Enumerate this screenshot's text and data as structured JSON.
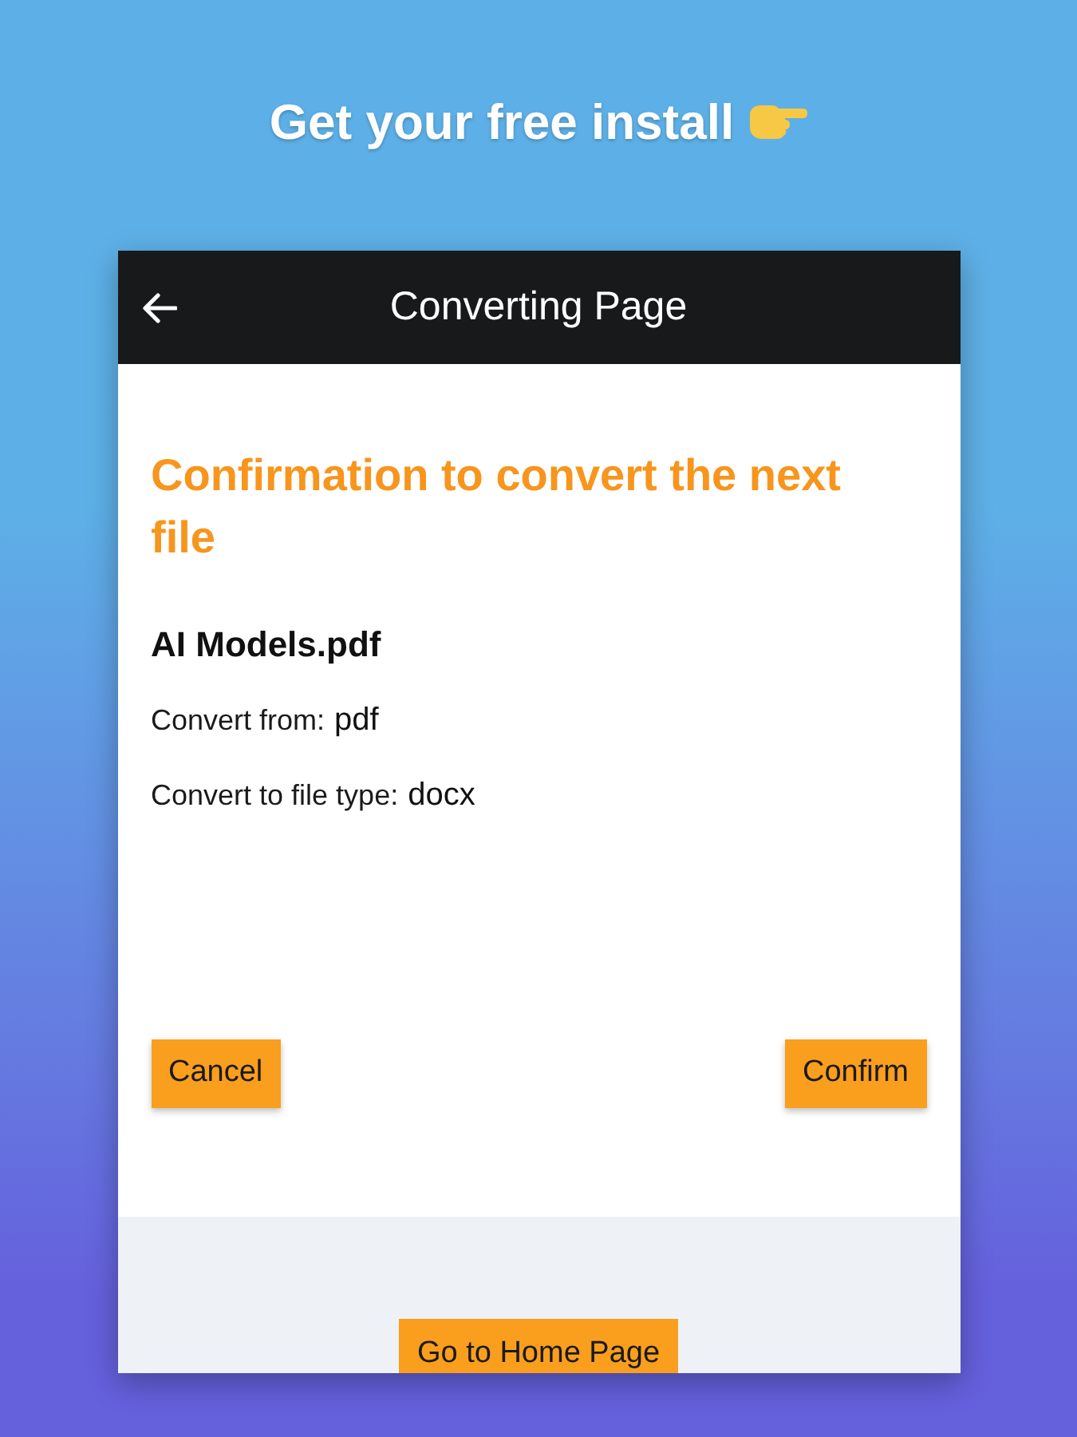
{
  "promo": {
    "headline": "Get your free install"
  },
  "app_bar": {
    "title": "Converting Page"
  },
  "confirmation": {
    "heading": "Confirmation to convert the next file",
    "file_name": "AI Models.pdf",
    "fields": [
      {
        "label": "Convert from:",
        "value": "pdf"
      },
      {
        "label": "Convert to file type:",
        "value": "docx"
      }
    ],
    "buttons": [
      "Cancel",
      "Confirm"
    ]
  },
  "footer": {
    "button": "Go to Home Page"
  }
}
